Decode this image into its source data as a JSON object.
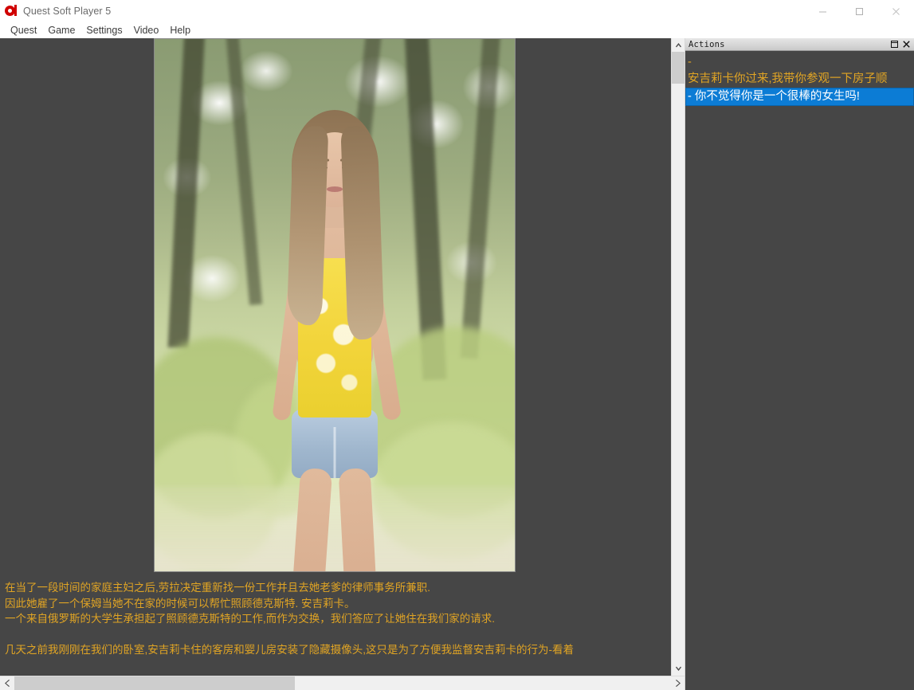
{
  "window": {
    "title": "Quest Soft Player 5",
    "icon": "app-logo-icon",
    "controls": {
      "minimize": "—",
      "maximize": "☐",
      "close": "✕"
    }
  },
  "menubar": {
    "items": [
      {
        "label": "Quest"
      },
      {
        "label": "Game"
      },
      {
        "label": "Settings"
      },
      {
        "label": "Video"
      },
      {
        "label": "Help"
      }
    ]
  },
  "story": {
    "image_alt": "young woman in yellow tank top and denim shorts outdoors",
    "paragraphs": [
      "在当了一段时间的家庭主妇之后,劳拉决定重新找一份工作并且去她老爹的律师事务所兼职.",
      "因此她雇了一个保姆当她不在家的时候可以帮忙照顾德克斯特. 安吉莉卡。",
      "一个来自俄罗斯的大学生承担起了照顾德克斯特的工作,而作为交换，我们答应了让她住在我们家的请求.",
      "几天之前我刚刚在我们的卧室,安吉莉卡住的客房和婴儿房安装了隐藏摄像头,这只是为了方便我监督安吉莉卡的行为-看着"
    ],
    "text_color": "#e0a424",
    "background_color": "#464646"
  },
  "actions_panel": {
    "title": "Actions",
    "controls": {
      "restore": "❐",
      "close": "✕"
    },
    "items": [
      {
        "label": "-",
        "label2": "安吉莉卡你过来,我带你参观一下房子顺",
        "selected": false
      },
      {
        "label": "- 你不觉得你是一个很棒的女生吗!",
        "selected": true
      }
    ],
    "selected_bg": "#0c7cd5",
    "selected_fg": "#ffffff",
    "item_color": "#e0a424"
  },
  "scrollbars": {
    "vertical": {
      "up": "▲",
      "down": "▼"
    },
    "horizontal": {
      "left": "‹",
      "right": "›"
    }
  }
}
